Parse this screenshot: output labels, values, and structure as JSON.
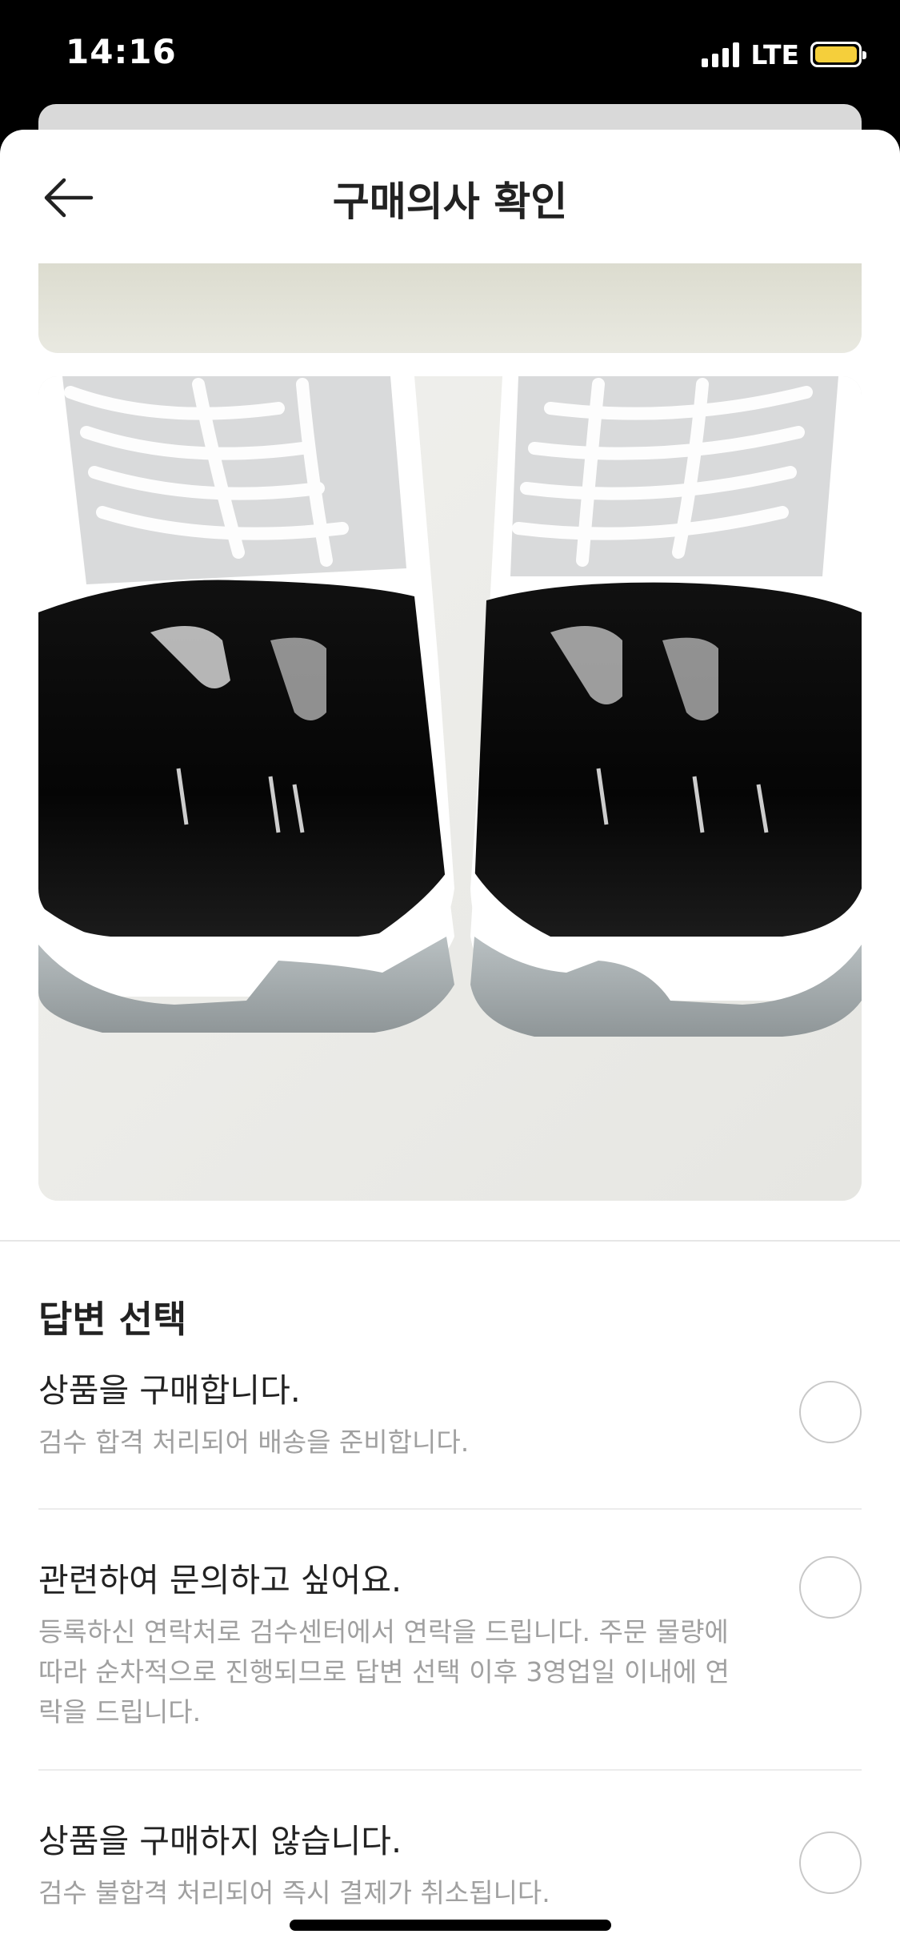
{
  "status_bar": {
    "time": "14:16",
    "network": "LTE",
    "battery_color": "#f5cf3b"
  },
  "header": {
    "title": "구매의사 확인",
    "back_icon": "arrow-left-icon"
  },
  "answer_section": {
    "title": "답변 선택",
    "options": [
      {
        "title": "상품을 구매합니다.",
        "description": "검수 합격 처리되어 배송을 준비합니다.",
        "selected": false
      },
      {
        "title": "관련하여 문의하고 싶어요.",
        "description": "등록하신 연락처로 검수센터에서 연락을 드립니다. 주문 물량에 따라 순차적으로 진행되므로 답변 선택 이후 3영업일 이내에 연락을 드립니다.",
        "selected": false
      },
      {
        "title": "상품을 구매하지 않습니다.",
        "description": "검수 불합격 처리되어 즉시 결제가 취소됩니다.",
        "selected": false
      }
    ]
  }
}
